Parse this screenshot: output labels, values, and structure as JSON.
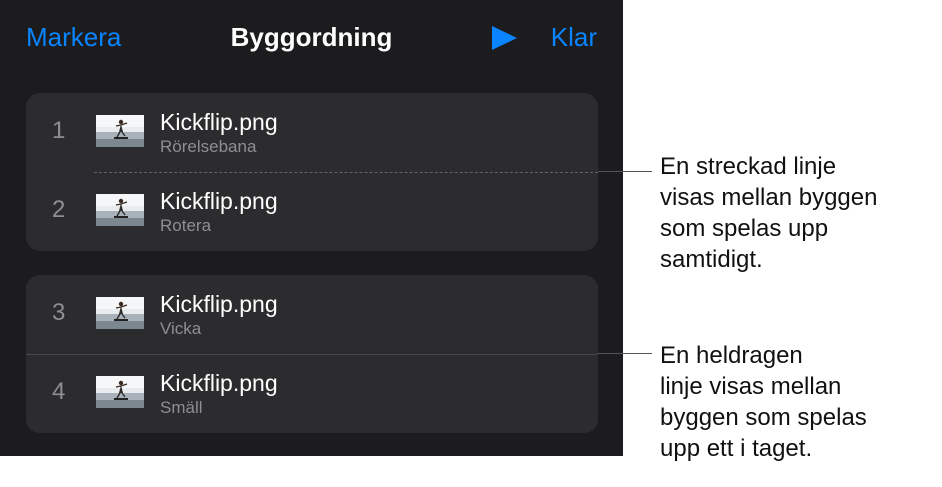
{
  "nav": {
    "left_label": "Markera",
    "title": "Byggordning",
    "right_label": "Klar",
    "play_icon": "play-icon",
    "accent": "#0a84ff"
  },
  "groups": [
    {
      "separator": "dashed",
      "items": [
        {
          "number": "1",
          "title": "Kickflip.png",
          "subtitle": "Rörelsebana"
        },
        {
          "number": "2",
          "title": "Kickflip.png",
          "subtitle": "Rotera"
        }
      ]
    },
    {
      "separator": "solid",
      "items": [
        {
          "number": "3",
          "title": "Kickflip.png",
          "subtitle": "Vicka"
        },
        {
          "number": "4",
          "title": "Kickflip.png",
          "subtitle": "Smäll"
        }
      ]
    }
  ],
  "callouts": {
    "dashed": "En streckad linje\nvisas mellan byggen\nsom spelas upp\nsamtidigt.",
    "solid": "En heldragen\nlinje visas mellan\nbyggen som spelas\nupp ett i taget."
  }
}
